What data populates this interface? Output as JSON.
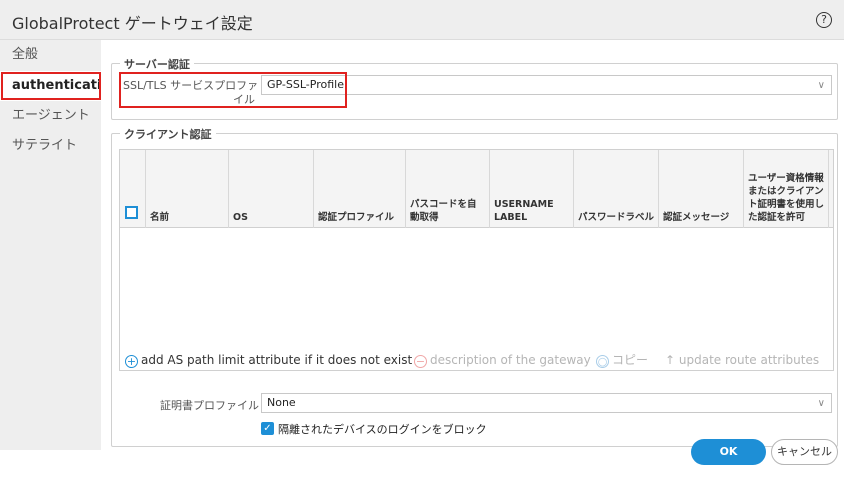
{
  "window": {
    "title": "GlobalProtect ゲートウェイ設定",
    "help_icon": "?"
  },
  "sidebar": {
    "items": [
      {
        "label": "全般"
      },
      {
        "label": "authenticatio"
      },
      {
        "label": "エージェント"
      },
      {
        "label": "サテライト"
      }
    ]
  },
  "server_auth": {
    "legend": "サーバー認証",
    "ssl_label_line1": "SSL/TLS サービスプロファ",
    "ssl_label_line2": "イル",
    "ssl_value": "GP-SSL-Profile"
  },
  "client_auth": {
    "legend": "クライアント認証",
    "columns": [
      "名前",
      "OS",
      "認証プロファイル",
      "パスコードを自動取得",
      "USERNAME LABEL",
      "パスワードラベル",
      "認証メッセージ",
      "ユーザー資格情報またはクライアント証明書を使用した認証を許可"
    ],
    "toolbar": {
      "add": "add AS path limit attribute if it does not exist",
      "delete": "description of the gateway",
      "copy": "コピー",
      "update": "update route attributes"
    }
  },
  "cert": {
    "label": "証明書プロファイル",
    "value": "None"
  },
  "block": {
    "label": "隔離されたデバイスのログインをブロック",
    "checked": true
  },
  "buttons": {
    "ok": "OK",
    "cancel": "キャンセル"
  },
  "colors": {
    "accent": "#1e8fd6",
    "highlight": "#e0221f"
  }
}
